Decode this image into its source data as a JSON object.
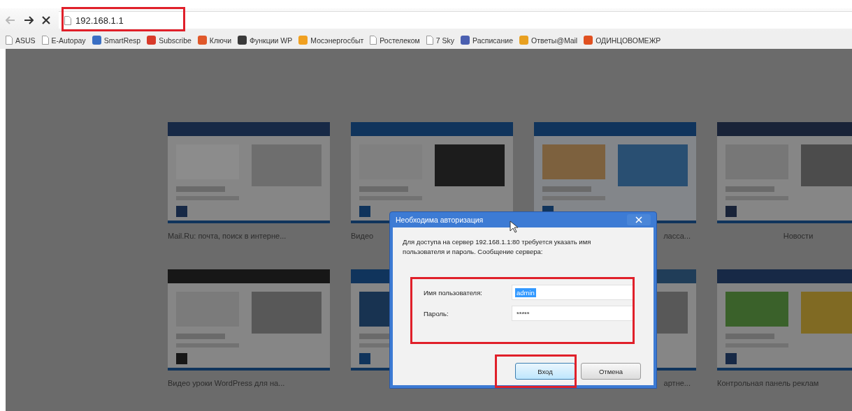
{
  "toolbar": {
    "url": "192.168.1.1"
  },
  "bookmarks": [
    {
      "label": "ASUS",
      "kind": "page"
    },
    {
      "label": "E-Autopay",
      "kind": "page"
    },
    {
      "label": "SmartResp",
      "kind": "site",
      "color": "#3a6fc4"
    },
    {
      "label": "Subscribe",
      "kind": "site",
      "color": "#d83a2a"
    },
    {
      "label": "Ключи",
      "kind": "site",
      "color": "#e0582a"
    },
    {
      "label": "Функции WP",
      "kind": "site",
      "color": "#3a3a3a"
    },
    {
      "label": "Мосэнергосбыт",
      "kind": "site",
      "color": "#f0a020"
    },
    {
      "label": "Ростелеком",
      "kind": "page"
    },
    {
      "label": "7 Sky",
      "kind": "page"
    },
    {
      "label": "Расписание",
      "kind": "site",
      "color": "#4a5fb0"
    },
    {
      "label": "Ответы@Mail",
      "kind": "site",
      "color": "#e8a020"
    },
    {
      "label": "ОДИНЦОВОМЕЖР",
      "kind": "site",
      "color": "#e05020"
    }
  ],
  "thumbnails": [
    {
      "kind": "picture",
      "caption": "Mail.Ru: почта, поиск в интерне..."
    },
    {
      "kind": "picture",
      "caption": "Видео"
    },
    {
      "kind": "picture",
      "caption": "ласса..."
    },
    {
      "kind": "picture",
      "caption": "Новости"
    },
    {
      "kind": "picture",
      "caption": "Видео уроки WordPress для на..."
    },
    {
      "kind": "picture"
    },
    {
      "kind": "picture",
      "caption": "артне..."
    },
    {
      "kind": "picture",
      "caption": "Контрольная панель реклам"
    }
  ],
  "dialog": {
    "title": "Необходима авторизация",
    "message": "Для доступа на сервер 192.168.1.1:80 требуется указать имя пользователя и пароль. Сообщение сервера:",
    "fields": [
      {
        "label": "Имя пользователя:",
        "value": "admin",
        "selected": true
      },
      {
        "label": "Пароль:",
        "value": "*****",
        "selected": false
      }
    ],
    "buttons": [
      {
        "label": "Вход",
        "default": true
      },
      {
        "label": "Отмена",
        "default": false
      }
    ]
  }
}
